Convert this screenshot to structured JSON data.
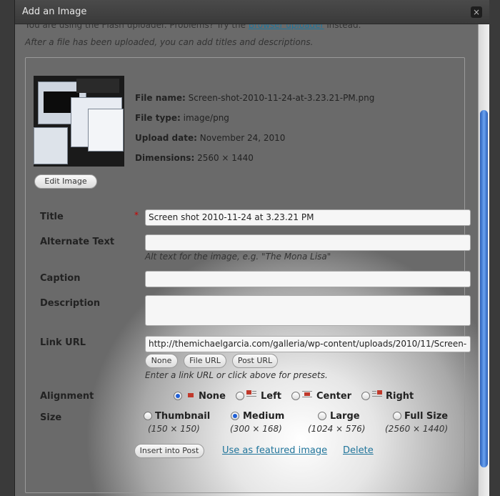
{
  "dialog": {
    "title": "Add an Image",
    "close_glyph": "×"
  },
  "intro": {
    "text_before": "You are using the Flash uploader. Problems? Try the ",
    "link": "Browser uploader",
    "text_after": " instead.",
    "line2": "After a file has been uploaded, you can add titles and descriptions."
  },
  "file": {
    "name_label": "File name:",
    "name": "Screen-shot-2010-11-24-at-3.23.21-PM.png",
    "type_label": "File type:",
    "type": "image/png",
    "date_label": "Upload date:",
    "date": "November 24, 2010",
    "dim_label": "Dimensions:",
    "dimensions": "2560 × 1440",
    "edit_button": "Edit Image"
  },
  "form": {
    "title_label": "Title",
    "required_mark": "*",
    "title_value": "Screen shot 2010-11-24 at 3.23.21 PM",
    "alt_label": "Alternate Text",
    "alt_value": "",
    "alt_help": "Alt text for the image, e.g. \"The Mona Lisa\"",
    "caption_label": "Caption",
    "caption_value": "",
    "description_label": "Description",
    "description_value": "",
    "link_label": "Link URL",
    "link_value": "http://themichaelgarcia.com/galleria/wp-content/uploads/2010/11/Screen-",
    "link_buttons": [
      "None",
      "File URL",
      "Post URL"
    ],
    "link_help": "Enter a link URL or click above for presets.",
    "alignment_label": "Alignment",
    "alignment_options": [
      "None",
      "Left",
      "Center",
      "Right"
    ],
    "alignment_selected": "None",
    "size_label": "Size",
    "size_options": [
      {
        "label": "Thumbnail",
        "dims": "(150 × 150)"
      },
      {
        "label": "Medium",
        "dims": "(300 × 168)"
      },
      {
        "label": "Large",
        "dims": "(1024 × 576)"
      },
      {
        "label": "Full Size",
        "dims": "(2560 × 1440)"
      }
    ],
    "size_selected": "Medium"
  },
  "actions": {
    "insert": "Insert into Post",
    "featured": "Use as featured image",
    "delete": "Delete"
  },
  "colors": {
    "link": "#21759b",
    "radio_selected": "#1f5fd6",
    "required": "#cc0000"
  }
}
